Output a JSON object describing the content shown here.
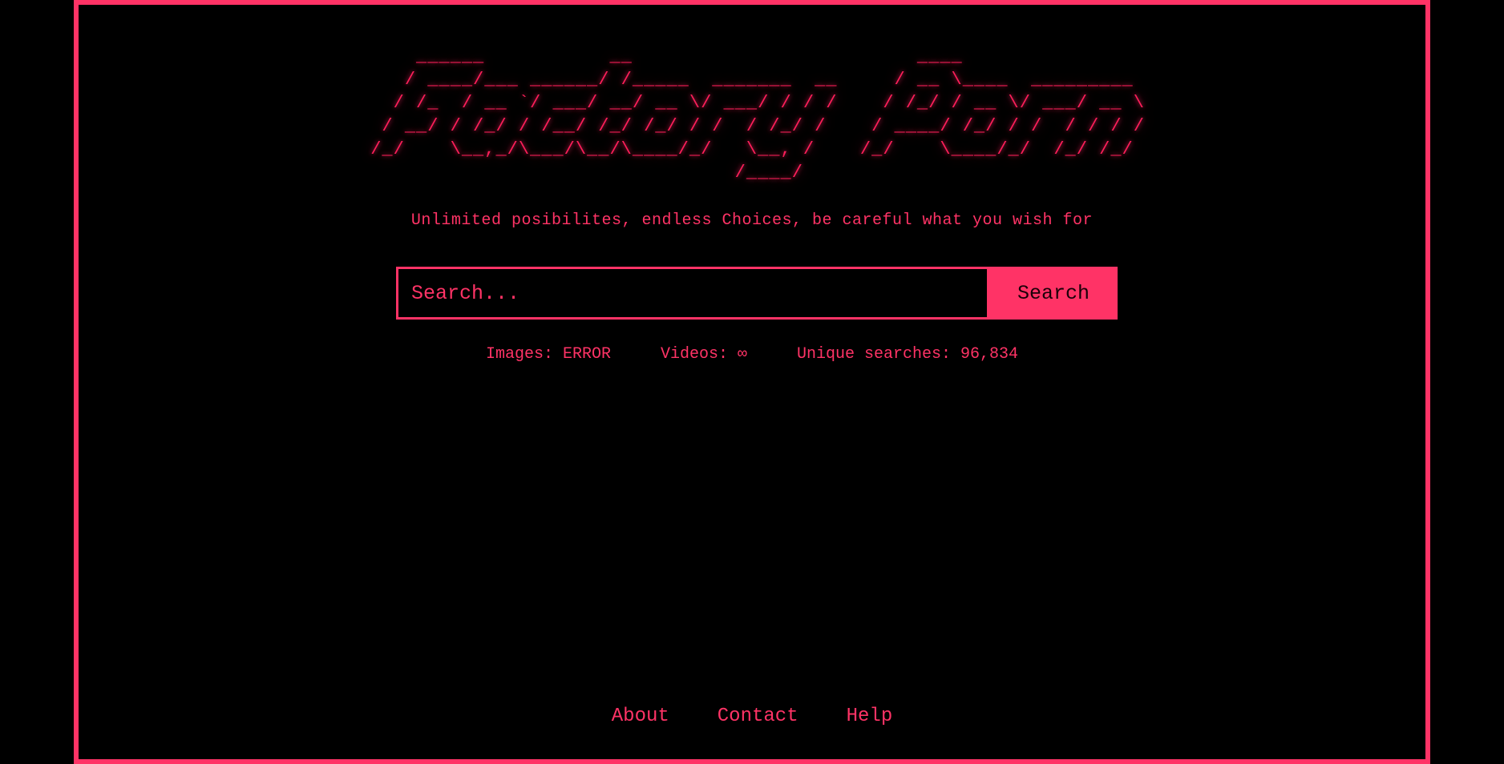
{
  "logo": {
    "text": "     ______           __                         ____\n    / ____/___ ______/ /_____  _______  __     / __ \\____  _________\n   / /_  / __ `/ ___/ __/ __ \\/ ___/ / / /    / /_/ / __ \\/ ___/ __ \\\n  / __/ / /_/ / /__/ /_/ /_/ / /  / /_/ /    / ____/ /_/ / /  / / / /\n /_/    \\__,_/\\___/\\__/\\____/_/   \\__, /    /_/    \\____/_/  /_/ /_/\n                                 /____/"
  },
  "tagline": "Unlimited posibilites, endless Choices, be careful what you wish for",
  "search": {
    "placeholder": "Search...",
    "button_label": "Search"
  },
  "stats": {
    "images": "Images: ERROR",
    "videos": "Videos: ∞",
    "unique_searches": "Unique searches: 96,834"
  },
  "footer": {
    "about": "About",
    "contact": "Contact",
    "help": "Help"
  },
  "colors": {
    "accent": "#ff3366",
    "background": "#000000"
  }
}
